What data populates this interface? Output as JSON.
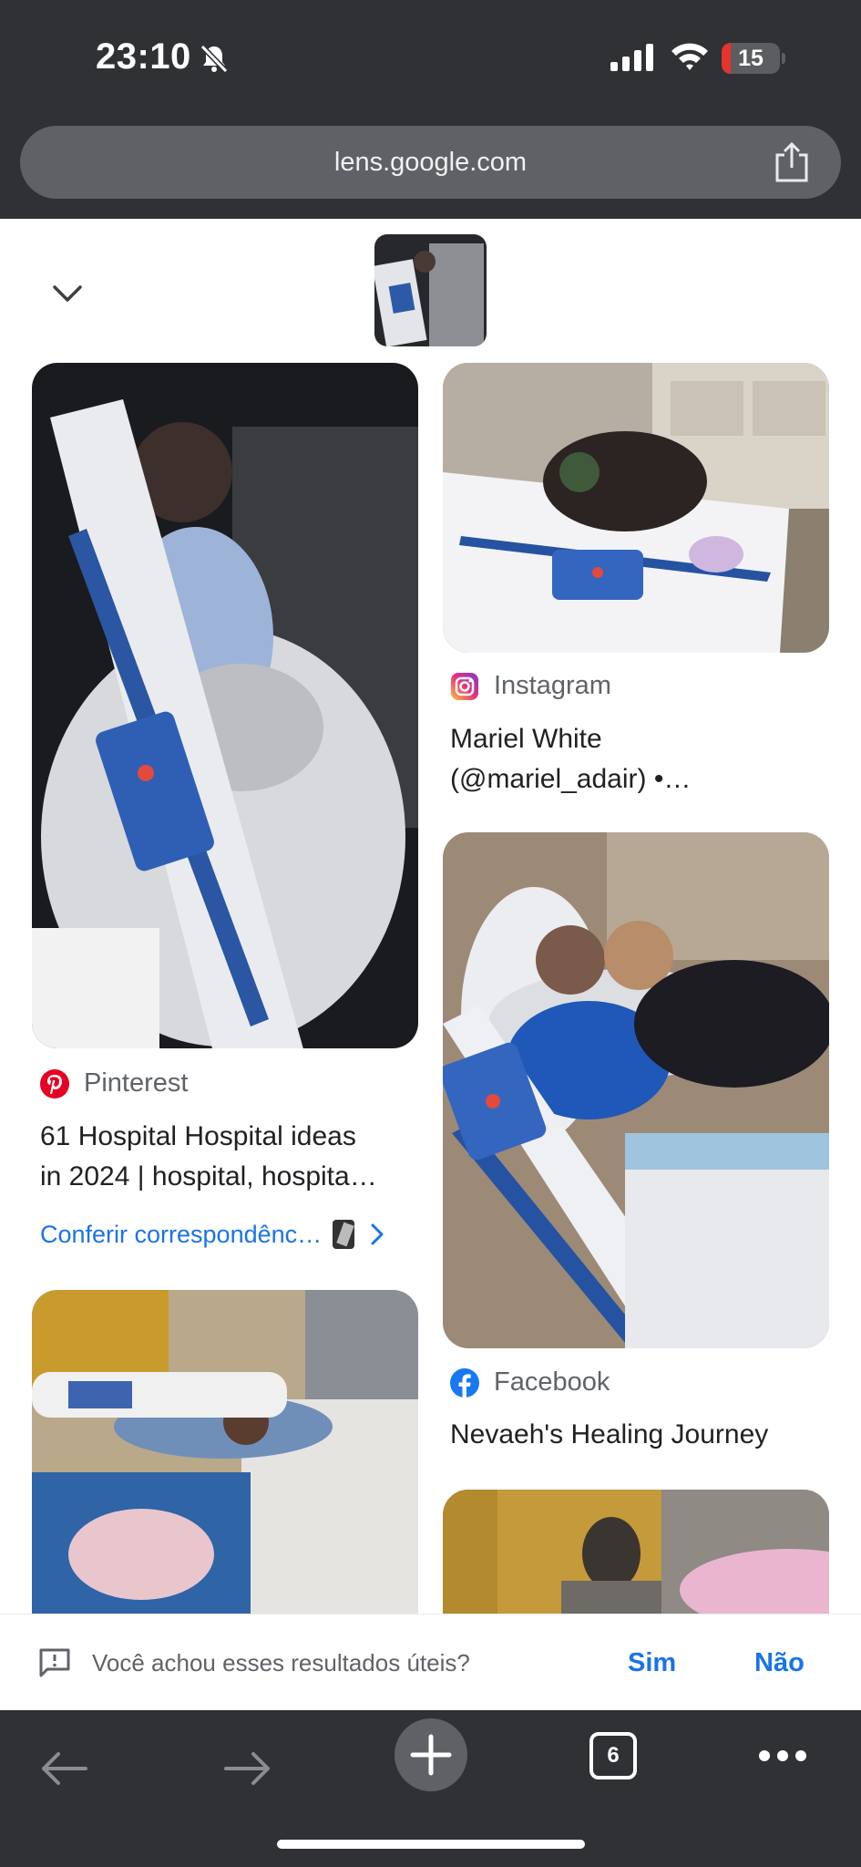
{
  "status_bar": {
    "time": "23:10",
    "battery_level": "15",
    "battery_fraction": 0.15,
    "icons": [
      "bell-slash-icon",
      "cellular-signal-icon",
      "wifi-icon",
      "battery-icon"
    ]
  },
  "browser": {
    "url": "lens.google.com",
    "share_icon": "share-icon"
  },
  "lens": {
    "collapse_icon": "chevron-down-icon",
    "query_image": "hospital-bed-query-thumbnail"
  },
  "results": [
    {
      "source": "Pinterest",
      "source_icon": "pinterest-icon",
      "title_line1": "61 Hospital Hospital ideas",
      "title_line2": "in 2024 | hospital, hospita…",
      "check_link": "Conferir correspondênc…"
    },
    {
      "source": "Instagram",
      "source_icon": "instagram-icon",
      "title_line1": "Mariel White",
      "title_line2": "(@mariel_adair) •…"
    },
    {
      "source": "Facebook",
      "source_icon": "facebook-icon",
      "title_line1": "Nevaeh's Healing Journey"
    }
  ],
  "feedback": {
    "question": "Você achou esses resultados úteis?",
    "yes": "Sim",
    "no": "Não"
  },
  "toolbar": {
    "tab_count": "6",
    "icons": [
      "back-arrow-icon",
      "forward-arrow-icon",
      "new-tab-plus-icon",
      "tab-switcher-icon",
      "more-menu-icon"
    ]
  },
  "colors": {
    "chrome": "#2f3135",
    "url_pill": "#5f6166",
    "link_blue": "#1a73e8",
    "battery_red": "#e5342e",
    "pinterest_red": "#e60023",
    "facebook_blue": "#1877f2"
  }
}
